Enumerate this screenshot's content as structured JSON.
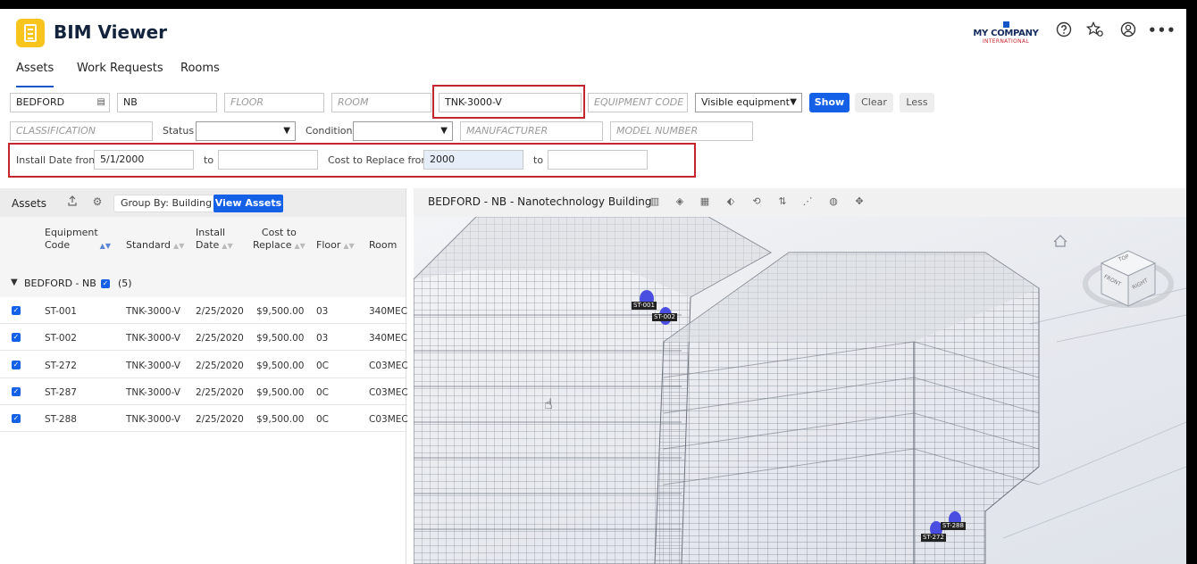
{
  "app": {
    "title": "BIM Viewer"
  },
  "company": {
    "name": "MY COMPANY",
    "subtitle": "INTERNATIONAL"
  },
  "header_icons": [
    "help-icon",
    "favorites-icon",
    "account-icon",
    "more-icon"
  ],
  "tabs": [
    {
      "label": "Assets",
      "active": true
    },
    {
      "label": "Work Requests",
      "active": false
    },
    {
      "label": "Rooms",
      "active": false
    }
  ],
  "filters": {
    "site": "BEDFORD",
    "building": "NB",
    "floor_placeholder": "FLOOR",
    "room_placeholder": "ROOM",
    "standard": "TNK-3000-V",
    "equipment_code_placeholder": "EQUIPMENT CODE",
    "visibility": "Visible equipment",
    "classification_placeholder": "CLASSIFICATION",
    "status_label": "Status",
    "condition_label": "Condition",
    "manufacturer_placeholder": "MANUFACTURER",
    "model_placeholder": "MODEL NUMBER",
    "install_date_label": "Install Date from",
    "install_date_from": "5/1/2000",
    "to_label": "to",
    "cost_label": "Cost to Replace from",
    "cost_from": "2000"
  },
  "buttons": {
    "show": "Show",
    "clear": "Clear",
    "less": "Less"
  },
  "assets_panel": {
    "title": "Assets",
    "group_by": "Group By: Building",
    "view_assets": "View Assets",
    "columns": {
      "equipment_code": [
        "Equipment",
        "Code"
      ],
      "standard": "Standard",
      "install_date": [
        "Install",
        "Date"
      ],
      "cost": [
        "Cost to",
        "Replace"
      ],
      "floor": "Floor",
      "room": "Room"
    },
    "group": {
      "name": "BEDFORD - NB",
      "count": "(5)"
    },
    "rows": [
      {
        "code": "ST-001",
        "standard": "TNK-3000-V",
        "date": "2/25/2020",
        "cost": "$9,500.00",
        "floor": "03",
        "room": "340MEC"
      },
      {
        "code": "ST-002",
        "standard": "TNK-3000-V",
        "date": "2/25/2020",
        "cost": "$9,500.00",
        "floor": "03",
        "room": "340MEC"
      },
      {
        "code": "ST-272",
        "standard": "TNK-3000-V",
        "date": "2/25/2020",
        "cost": "$9,500.00",
        "floor": "0C",
        "room": "C03MEC"
      },
      {
        "code": "ST-287",
        "standard": "TNK-3000-V",
        "date": "2/25/2020",
        "cost": "$9,500.00",
        "floor": "0C",
        "room": "C03MEC"
      },
      {
        "code": "ST-288",
        "standard": "TNK-3000-V",
        "date": "2/25/2020",
        "cost": "$9,500.00",
        "floor": "0C",
        "room": "C03MEC"
      }
    ]
  },
  "viewer": {
    "title": "BEDFORD - NB - Nanotechnology Building",
    "cube": {
      "top": "TOP",
      "front": "FRONT",
      "right": "RIGHT"
    },
    "tags": {
      "st001": "ST-001",
      "st002": "ST-002",
      "st272": "ST-272",
      "st288": "ST-288"
    }
  },
  "colors": {
    "accent": "#1460e6",
    "highlight_border": "#c4262e",
    "logo": "#f7c51e"
  }
}
